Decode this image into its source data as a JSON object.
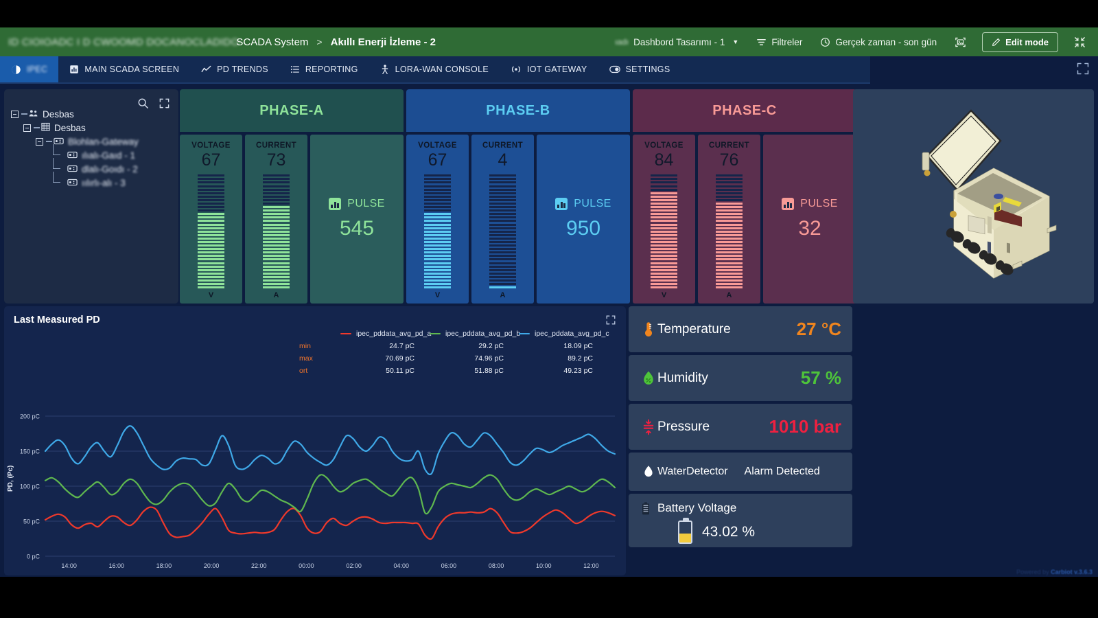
{
  "header": {
    "brand_blurred": "ID CIOIOADC I D CWOOMD DOCANOCLADIDO",
    "brand_plain": "SCADA System",
    "breadcrumb_separator": ">",
    "breadcrumb_current": "Akıllı Enerji İzleme - 2",
    "dashboard_select_blurred": "ıadı",
    "dashboard_select": "Dashbord Tasarımı - 1",
    "filters_label": "Filtreler",
    "time_range_label": "Gerçek zaman - son gün",
    "screenshot_icon": "image-capture-icon",
    "edit_mode_label": "Edit mode",
    "collapse_icon": "collapse-icon",
    "accent_green": "#2f6b35"
  },
  "tabs": [
    {
      "label": "IPEC",
      "icon": "logo-icon",
      "blurred": true,
      "active": true
    },
    {
      "label": "MAIN SCADA SCREEN",
      "icon": "chart-bar-icon",
      "blurred": false,
      "active": false
    },
    {
      "label": "PD TRENDS",
      "icon": "trend-line-icon",
      "blurred": false,
      "active": false
    },
    {
      "label": "REPORTING",
      "icon": "list-icon",
      "blurred": false,
      "active": false
    },
    {
      "label": "LORA-WAN CONSOLE",
      "icon": "antenna-person-icon",
      "blurred": false,
      "active": false
    },
    {
      "label": "IOT GATEWAY",
      "icon": "signal-icon",
      "blurred": false,
      "active": false
    },
    {
      "label": "SETTINGS",
      "icon": "toggle-icon",
      "blurred": false,
      "active": false
    }
  ],
  "tree": {
    "search_icon": "search-icon",
    "expand_icon": "expand-icon",
    "nodes": [
      {
        "label": "Desbas",
        "icon": "customers-icon",
        "depth": 0,
        "blurred": false,
        "expandable": true
      },
      {
        "label": "Desbas",
        "icon": "asset-icon",
        "depth": 1,
        "blurred": false,
        "expandable": true
      },
      {
        "label": "Blohlan-Gateway",
        "icon": "device-icon",
        "depth": 2,
        "blurred": true,
        "expandable": true
      },
      {
        "label": "ılıalı-Gaıd - 1",
        "icon": "device-icon",
        "depth": 3,
        "blurred": true,
        "expandable": false
      },
      {
        "label": "dlalı-Goıdı - 2",
        "icon": "device-icon",
        "depth": 3,
        "blurred": true,
        "expandable": false
      },
      {
        "label": "ıılırlı-alı - 3",
        "icon": "device-icon",
        "depth": 3,
        "blurred": true,
        "expandable": false
      }
    ]
  },
  "phases": [
    {
      "title": "PHASE-A",
      "accent": "#8fe39a",
      "header_bg": "#20504f",
      "panel_bg": "#275858",
      "pulse_bg": "#2b5d5c",
      "voltage_label": "VOLTAGE",
      "voltage_value": "67",
      "voltage_unit": "V",
      "voltage_pct": 67,
      "current_label": "CURRENT",
      "current_value": "73",
      "current_unit": "A",
      "current_pct": 73,
      "pulse_label": "PULSE",
      "pulse_value": "545"
    },
    {
      "title": "PHASE-B",
      "accent": "#5ccdf2",
      "header_bg": "#1c4d92",
      "panel_bg": "#1d4f95",
      "pulse_bg": "#1d4f95",
      "voltage_label": "VOLTAGE",
      "voltage_value": "67",
      "voltage_unit": "V",
      "voltage_pct": 67,
      "current_label": "CURRENT",
      "current_value": "4",
      "current_unit": "A",
      "current_pct": 4,
      "pulse_label": "PULSE",
      "pulse_value": "950"
    },
    {
      "title": "PHASE-C",
      "accent": "#f89a96",
      "header_bg": "#5c2b4b",
      "panel_bg": "#5b2f4e",
      "pulse_bg": "#5b2f4e",
      "voltage_label": "VOLTAGE",
      "voltage_value": "84",
      "voltage_unit": "V",
      "voltage_pct": 84,
      "current_label": "CURRENT",
      "current_value": "76",
      "current_unit": "A",
      "current_pct": 76,
      "pulse_label": "PULSE",
      "pulse_value": "32"
    }
  ],
  "device_image": {
    "alt": "enclosure-cabinet-3d-render"
  },
  "chart_card": {
    "title": "Last Measured PD",
    "expand_icon": "expand-icon"
  },
  "chart_data": {
    "type": "line",
    "title": "Last Measured PD",
    "xlabel": "",
    "ylabel": "PD, (Pc)",
    "ylim": [
      0,
      200
    ],
    "yticks": [
      "0 pC",
      "50 pC",
      "100 pC",
      "150 pC",
      "200 pC"
    ],
    "ytick_values": [
      0,
      50,
      100,
      150,
      200
    ],
    "xticks": [
      "14:00",
      "16:00",
      "18:00",
      "20:00",
      "22:00",
      "00:00",
      "02:00",
      "04:00",
      "06:00",
      "08:00",
      "10:00",
      "12:00"
    ],
    "grid": true,
    "legend_position": "top-right",
    "stat_rows": [
      "min",
      "max",
      "ort"
    ],
    "series": [
      {
        "name": "ipec_pddata_avg_pd_a",
        "color": "#f0392b",
        "min": "24.7 pC",
        "max": "70.69 pC",
        "ort": "50.11 pC",
        "values": [
          52,
          57,
          60,
          56,
          45,
          40,
          45,
          47,
          42,
          50,
          57,
          56,
          48,
          44,
          52,
          64,
          70,
          66,
          48,
          32,
          27,
          28,
          30,
          38,
          48,
          60,
          68,
          55,
          37,
          33,
          32,
          33,
          34,
          33,
          34,
          38,
          52,
          64,
          68,
          58,
          40,
          33,
          35,
          48,
          54,
          47,
          44,
          50,
          55,
          56,
          53,
          48,
          47,
          48,
          48,
          48,
          47,
          46,
          30,
          25,
          42,
          54,
          60,
          62,
          62,
          63,
          62,
          63,
          68,
          62,
          48,
          35,
          33,
          35,
          40,
          48,
          56,
          62,
          66,
          62,
          54,
          47,
          50,
          57,
          62,
          64,
          62,
          58
        ]
      },
      {
        "name": "ipec_pddata_avg_pd_b",
        "color": "#5fb84f",
        "min": "29.2 pC",
        "max": "74.96 pC",
        "ort": "51.88 pC",
        "values": [
          108,
          112,
          106,
          96,
          88,
          84,
          92,
          100,
          106,
          98,
          88,
          92,
          104,
          110,
          104,
          90,
          78,
          74,
          80,
          92,
          100,
          104,
          102,
          92,
          80,
          72,
          76,
          92,
          104,
          96,
          82,
          78,
          86,
          94,
          92,
          86,
          80,
          76,
          70,
          64,
          82,
          104,
          116,
          112,
          100,
          92,
          96,
          104,
          108,
          110,
          104,
          96,
          90,
          86,
          96,
          108,
          112,
          96,
          62,
          70,
          92,
          100,
          104,
          102,
          100,
          98,
          104,
          112,
          116,
          110,
          96,
          84,
          80,
          84,
          92,
          96,
          92,
          88,
          92,
          96,
          100,
          96,
          92,
          96,
          104,
          110,
          106,
          98
        ]
      },
      {
        "name": "ipec_pddata_avg_pd_c",
        "color": "#3fa9e8",
        "min": "18.09 pC",
        "max": "89.2 pC",
        "ort": "49.23 pC",
        "values": [
          150,
          160,
          166,
          158,
          140,
          132,
          142,
          156,
          162,
          150,
          142,
          158,
          178,
          186,
          176,
          158,
          140,
          130,
          124,
          126,
          136,
          140,
          139,
          138,
          130,
          132,
          152,
          172,
          158,
          130,
          124,
          128,
          138,
          144,
          140,
          132,
          136,
          152,
          164,
          160,
          148,
          140,
          134,
          130,
          138,
          156,
          172,
          168,
          156,
          150,
          158,
          170,
          166,
          150,
          140,
          136,
          138,
          150,
          124,
          118,
          146,
          164,
          176,
          172,
          160,
          156,
          166,
          176,
          172,
          160,
          148,
          134,
          130,
          136,
          146,
          154,
          152,
          148,
          152,
          158,
          162,
          166,
          170,
          174,
          168,
          158,
          150,
          146
        ]
      }
    ]
  },
  "sensors": [
    {
      "name": "Temperature",
      "value": "27 °C",
      "color": "#f0851e",
      "icon": "thermometer-icon"
    },
    {
      "name": "Humidity",
      "value": "57 %",
      "color": "#4ec43a",
      "icon": "humidity-drop-icon"
    },
    {
      "name": "Pressure",
      "value": "1010 bar",
      "color": "#ef2040",
      "icon": "pressure-icon"
    },
    {
      "name": "WaterDetector",
      "value": "Alarm Detected",
      "color": "#ffffff",
      "icon": "water-drop-icon"
    }
  ],
  "battery": {
    "title": "Battery Voltage",
    "value": "43.02 %",
    "fill_pct": 43,
    "icon": "battery-icon",
    "fill_color": "#f2cb3e"
  },
  "footer": {
    "prefix": "Powered by",
    "brand": "Carbiot v.3.6.3"
  }
}
